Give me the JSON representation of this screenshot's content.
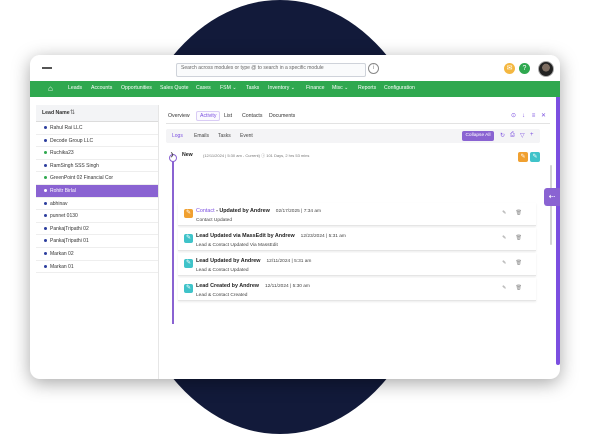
{
  "search": {
    "placeholder": "Search across modules or type @ to search in a specific module"
  },
  "topbar": {
    "help_symbol": "?"
  },
  "nav": {
    "items": [
      "Leads",
      "Accounts",
      "Opportunities",
      "Sales Quote",
      "Cases",
      "FSM ⌄",
      "Tasks",
      "Inventory ⌄",
      "Finance",
      "Misc ⌄",
      "Reports",
      "Configuration"
    ]
  },
  "left": {
    "header": "Lead Name",
    "leads": [
      {
        "name": "Rahul Rai LLC",
        "color": "#2c3e9e"
      },
      {
        "name": "Decode Group LLC",
        "color": "#2c3e9e"
      },
      {
        "name": "Ruchika23",
        "color": "#2fa84f"
      },
      {
        "name": "RamSingh SSS Singh",
        "color": "#2c3e9e"
      },
      {
        "name": "GreenPoint 02 Financial Cor",
        "color": "#2fa84f"
      },
      {
        "name": "Rohitr Birlal",
        "color": "#ffffff",
        "selected": true
      },
      {
        "name": "abhinav",
        "color": "#2c3e9e"
      },
      {
        "name": "punnet 0130",
        "color": "#2c3e9e"
      },
      {
        "name": "PankajTripathi 02",
        "color": "#2c3e9e"
      },
      {
        "name": "PankajTripathi 01",
        "color": "#2c3e9e"
      },
      {
        "name": "Markan 02",
        "color": "#2c3e9e"
      },
      {
        "name": "Markan 01",
        "color": "#2c3e9e"
      }
    ]
  },
  "main": {
    "tabs": [
      "Overview",
      "Activity",
      "List",
      "Contacts",
      "Documents"
    ],
    "active_tab": "Activity",
    "subtabs": [
      "Logs",
      "Emails",
      "Tasks",
      "Event"
    ],
    "collapse_label": "Collapse All",
    "section": {
      "label": "New",
      "meta": "(12/11/2024 | 5:30 am - Current)  ⓘ  101 Days, 2 hrs 53 mins"
    },
    "cards": [
      {
        "title_link": "Contact",
        "title": " - Updated by Andrew",
        "time": "02/17/2025 | 7:34 am",
        "sub": "Contact Updated",
        "icon_color": "#f0a030"
      },
      {
        "title_link": "",
        "title": "Lead Updated via MassEdit by Andrew",
        "time": "12/23/2024 | 5:31 am",
        "sub": "Lead & Contact Updated Via MassEdit",
        "icon_color": "#3fc3c9"
      },
      {
        "title_link": "",
        "title": "Lead Updated by Andrew",
        "time": "12/11/2024 | 5:31 am",
        "sub": "Lead & Contact Updated",
        "icon_color": "#3fc3c9"
      },
      {
        "title_link": "",
        "title": "Lead Created by Andrew",
        "time": "12/11/2024 | 5:30 am",
        "sub": "Lead & Contact Created",
        "icon_color": "#3fc3c9"
      }
    ]
  },
  "colors": {
    "nav_green": "#2fa84f",
    "accent_purple": "#8a63d2",
    "backdrop_navy": "#121a3a"
  }
}
